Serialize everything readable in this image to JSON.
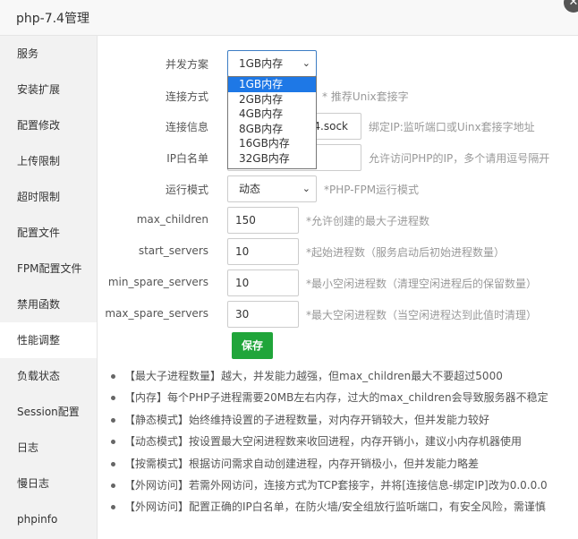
{
  "window": {
    "title": "php-7.4管理",
    "close_symbol": "✕"
  },
  "sidebar": {
    "items": [
      {
        "label": "服务"
      },
      {
        "label": "安装扩展"
      },
      {
        "label": "配置修改"
      },
      {
        "label": "上传限制"
      },
      {
        "label": "超时限制"
      },
      {
        "label": "配置文件"
      },
      {
        "label": "FPM配置文件"
      },
      {
        "label": "禁用函数"
      },
      {
        "label": "性能调整",
        "active": true
      },
      {
        "label": "负载状态"
      },
      {
        "label": "Session配置"
      },
      {
        "label": "日志"
      },
      {
        "label": "慢日志"
      },
      {
        "label": "phpinfo"
      }
    ]
  },
  "form": {
    "concurrency": {
      "label": "并发方案",
      "value": "1GB内存"
    },
    "dropdown_options": [
      "1GB内存",
      "2GB内存",
      "4GB内存",
      "8GB内存",
      "16GB内存",
      "32GB内存"
    ],
    "connection": {
      "label": "连接方式",
      "hint": "* 推荐Unix套接字"
    },
    "conn_info": {
      "label": "连接信息",
      "value_visible": "4.sock",
      "hint": "绑定IP:监听端口或Uinx套接字地址"
    },
    "ip_whitelist": {
      "label": "IP白名单",
      "value": "",
      "hint": "允许访问PHP的IP，多个请用逗号隔开"
    },
    "run_mode": {
      "label": "运行模式",
      "value": "动态",
      "hint": "*PHP-FPM运行模式"
    },
    "max_children": {
      "label": "max_children",
      "value": "150",
      "hint": "*允许创建的最大子进程数"
    },
    "start_servers": {
      "label": "start_servers",
      "value": "10",
      "hint": "*起始进程数（服务启动后初始进程数量）"
    },
    "min_spare_servers": {
      "label": "min_spare_servers",
      "value": "10",
      "hint": "*最小空闲进程数（清理空闲进程后的保留数量）"
    },
    "max_spare_servers": {
      "label": "max_spare_servers",
      "value": "30",
      "hint": "*最大空闲进程数（当空闲进程达到此值时清理）"
    },
    "save_label": "保存"
  },
  "tips": [
    "【最大子进程数量】越大，并发能力越强，但max_children最大不要超过5000",
    "【内存】每个PHP子进程需要20MB左右内存，过大的max_children会导致服务器不稳定",
    "【静态模式】始终维持设置的子进程数量，对内存开销较大，但并发能力较好",
    "【动态模式】按设置最大空闲进程数来收回进程，内存开销小，建议小内存机器使用",
    "【按需模式】根据访问需求自动创建进程，内存开销极小，但并发能力略差",
    "【外网访问】若需外网访问，连接方式为TCP套接字，并将[连接信息-绑定IP]改为0.0.0.0",
    "【外网访问】配置正确的IP白名单，在防火墙/安全组放行监听端口，有安全风险，需谨慎"
  ],
  "icons": {
    "chevron": "chevron-down-icon",
    "close": "close-icon"
  },
  "colors": {
    "save_button": "#20a53a",
    "dropdown_highlight": "#1e78e6",
    "focus_border": "#3c7dc4"
  }
}
